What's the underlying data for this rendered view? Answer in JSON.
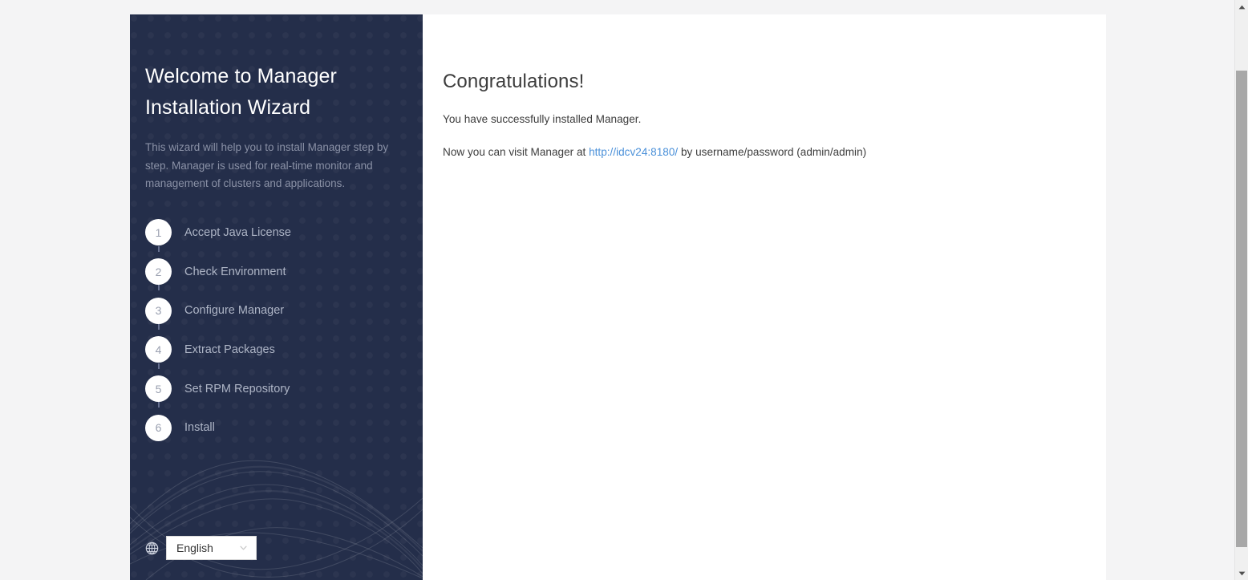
{
  "sidebar": {
    "title": "Welcome to Manager Installation Wizard",
    "description": "This wizard will help you to install Manager step by step. Manager is used for real-time monitor and management of clusters and applications.",
    "steps": [
      {
        "number": "1",
        "label": "Accept Java License"
      },
      {
        "number": "2",
        "label": "Check Environment"
      },
      {
        "number": "3",
        "label": "Configure Manager"
      },
      {
        "number": "4",
        "label": "Extract Packages"
      },
      {
        "number": "5",
        "label": "Set RPM Repository"
      },
      {
        "number": "6",
        "label": "Install"
      }
    ],
    "language": {
      "icon": "globe-icon",
      "selected": "English",
      "options": [
        "English"
      ],
      "chevron_icon": "chevron-down-icon"
    },
    "colors": {
      "background": "#242e4a",
      "title_text": "#ffffff",
      "description_text": "#8a91a6",
      "step_label_text": "#aeb5c6",
      "bullet_background": "#ffffff",
      "bullet_text": "#9aa0b0"
    }
  },
  "content": {
    "title": "Congratulations!",
    "line1": "You have successfully installed Manager.",
    "line2_prefix": "Now you can visit Manager at ",
    "link_text": "http://idcv24:8180/",
    "line2_suffix": " by username/password (admin/admin)",
    "colors": {
      "title_text": "#3c3c3c",
      "body_text": "#3d3d3d",
      "link": "#4a90d9",
      "background": "#ffffff"
    }
  },
  "scrollbar": {
    "up_arrow_icon": "scroll-up-arrow-icon",
    "down_arrow_icon": "scroll-down-arrow-icon",
    "thumb_name": "scrollbar-thumb"
  },
  "page": {
    "background": "#f4f4f5"
  }
}
